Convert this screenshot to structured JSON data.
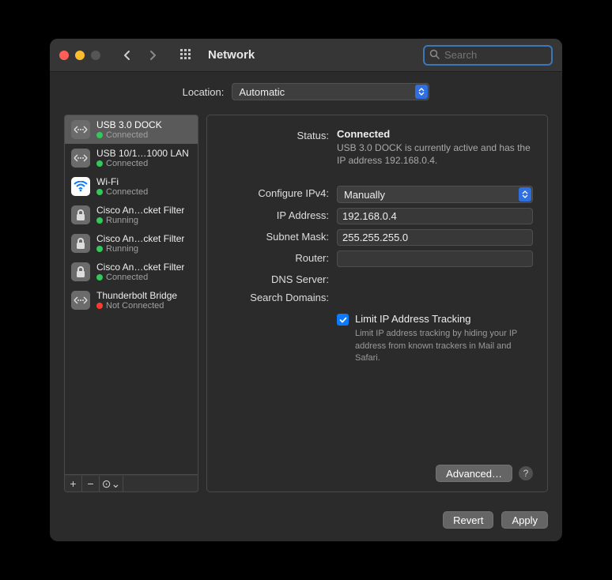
{
  "window": {
    "title": "Network"
  },
  "search": {
    "placeholder": "Search"
  },
  "location": {
    "label": "Location:",
    "value": "Automatic"
  },
  "sidebar": {
    "services": [
      {
        "name": "USB 3.0 DOCK",
        "status": "Connected",
        "dot": "green",
        "icon": "eth",
        "selected": true
      },
      {
        "name": "USB 10/1…1000 LAN",
        "status": "Connected",
        "dot": "green",
        "icon": "eth",
        "selected": false
      },
      {
        "name": "Wi-Fi",
        "status": "Connected",
        "dot": "green",
        "icon": "wifi",
        "selected": false
      },
      {
        "name": "Cisco An…cket Filter",
        "status": "Running",
        "dot": "green",
        "icon": "lock",
        "selected": false
      },
      {
        "name": "Cisco An…cket Filter",
        "status": "Running",
        "dot": "green",
        "icon": "lock",
        "selected": false
      },
      {
        "name": "Cisco An…cket Filter",
        "status": "Connected",
        "dot": "green",
        "icon": "lock",
        "selected": false
      },
      {
        "name": "Thunderbolt Bridge",
        "status": "Not Connected",
        "dot": "red",
        "icon": "eth",
        "selected": false
      }
    ],
    "buttons": {
      "add": "+",
      "remove": "−",
      "more": "⊙⌄"
    }
  },
  "detail": {
    "labels": {
      "status": "Status:",
      "configure": "Configure IPv4:",
      "ip": "IP Address:",
      "subnet": "Subnet Mask:",
      "router": "Router:",
      "dns": "DNS Server:",
      "searchdomains": "Search Domains:"
    },
    "status": "Connected",
    "status_desc": "USB 3.0 DOCK is currently active and has the IP address 192.168.0.4.",
    "configure": "Manually",
    "ip": "192.168.0.4",
    "subnet": "255.255.255.0",
    "router": "",
    "dns": "",
    "searchdomains": "",
    "limit_checked": true,
    "limit_label": "Limit IP Address Tracking",
    "limit_desc": "Limit IP address tracking by hiding your IP address from known trackers in Mail and Safari.",
    "advanced": "Advanced…"
  },
  "bottom": {
    "revert": "Revert",
    "apply": "Apply"
  }
}
